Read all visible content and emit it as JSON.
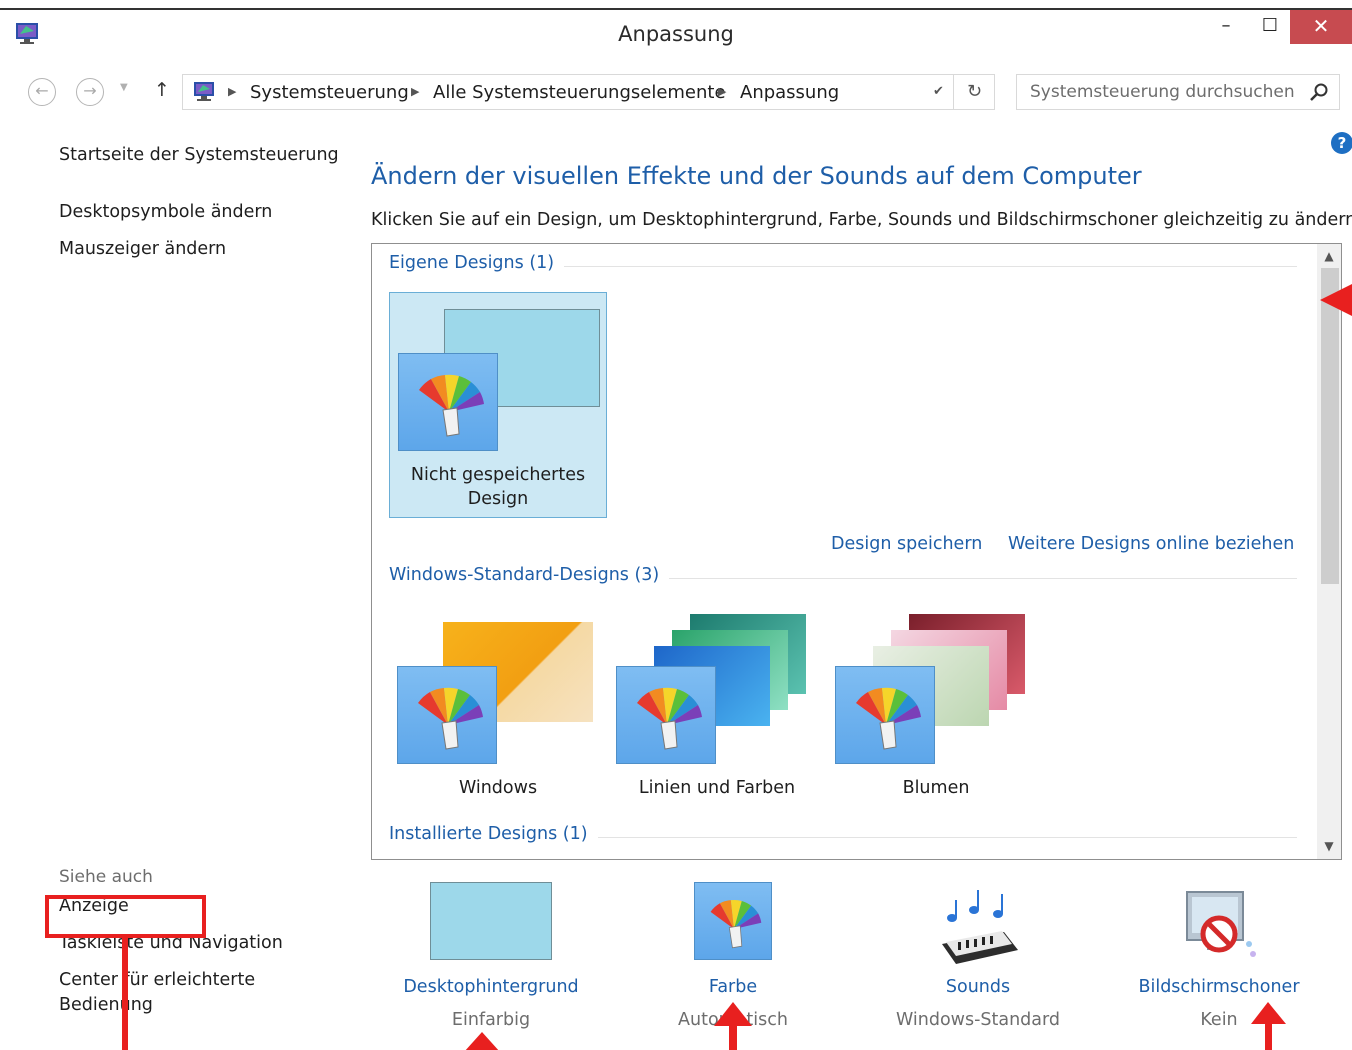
{
  "window": {
    "title": "Anpassung",
    "minimize": "–",
    "maximize": "☐",
    "close": "✕"
  },
  "addressbar": {
    "back": "←",
    "forward": "→",
    "up": "↑",
    "breadcrumbs": [
      "Systemsteuerung",
      "Alle Systemsteuerungselemente",
      "Anpassung"
    ],
    "refresh": "↻",
    "search_placeholder": "Systemsteuerung durchsuchen"
  },
  "help": "?",
  "sidebar": {
    "links": [
      "Startseite der Systemsteuerung",
      "Desktopsymbole ändern",
      "Mauszeiger ändern"
    ],
    "see_also_title": "Siehe auch",
    "see_also": [
      "Anzeige",
      "Taskleiste und Navigation",
      "Center für erleichterte",
      "Bedienung"
    ]
  },
  "main": {
    "heading": "Ändern der visuellen Effekte und der Sounds auf dem Computer",
    "description": "Klicken Sie auf ein Design, um Desktophintergrund, Farbe, Sounds und Bildschirmschoner gleichzeitig zu ändern.",
    "groups": {
      "own": "Eigene Designs (1)",
      "standard": "Windows-Standard-Designs (3)",
      "installed": "Installierte Designs (1)"
    },
    "unsaved_theme": [
      "Nicht gespeichertes",
      "Design"
    ],
    "standard_themes": [
      "Windows",
      "Linien und Farben",
      "Blumen"
    ],
    "actions": [
      "Design speichern",
      "Weitere Designs online beziehen"
    ]
  },
  "settings": [
    {
      "label": "Desktophintergrund",
      "value": "Einfarbig"
    },
    {
      "label": "Farbe",
      "value": "Automatisch"
    },
    {
      "label": "Sounds",
      "value": "Windows-Standard"
    },
    {
      "label": "Bildschirmschoner",
      "value": "Kein"
    }
  ],
  "colors": {
    "link": "#1e5ea8",
    "selection": "#cce8f4",
    "close_button": "#c74b50",
    "annotation": "#e8201f",
    "solid_background": "#9dd8ea"
  }
}
